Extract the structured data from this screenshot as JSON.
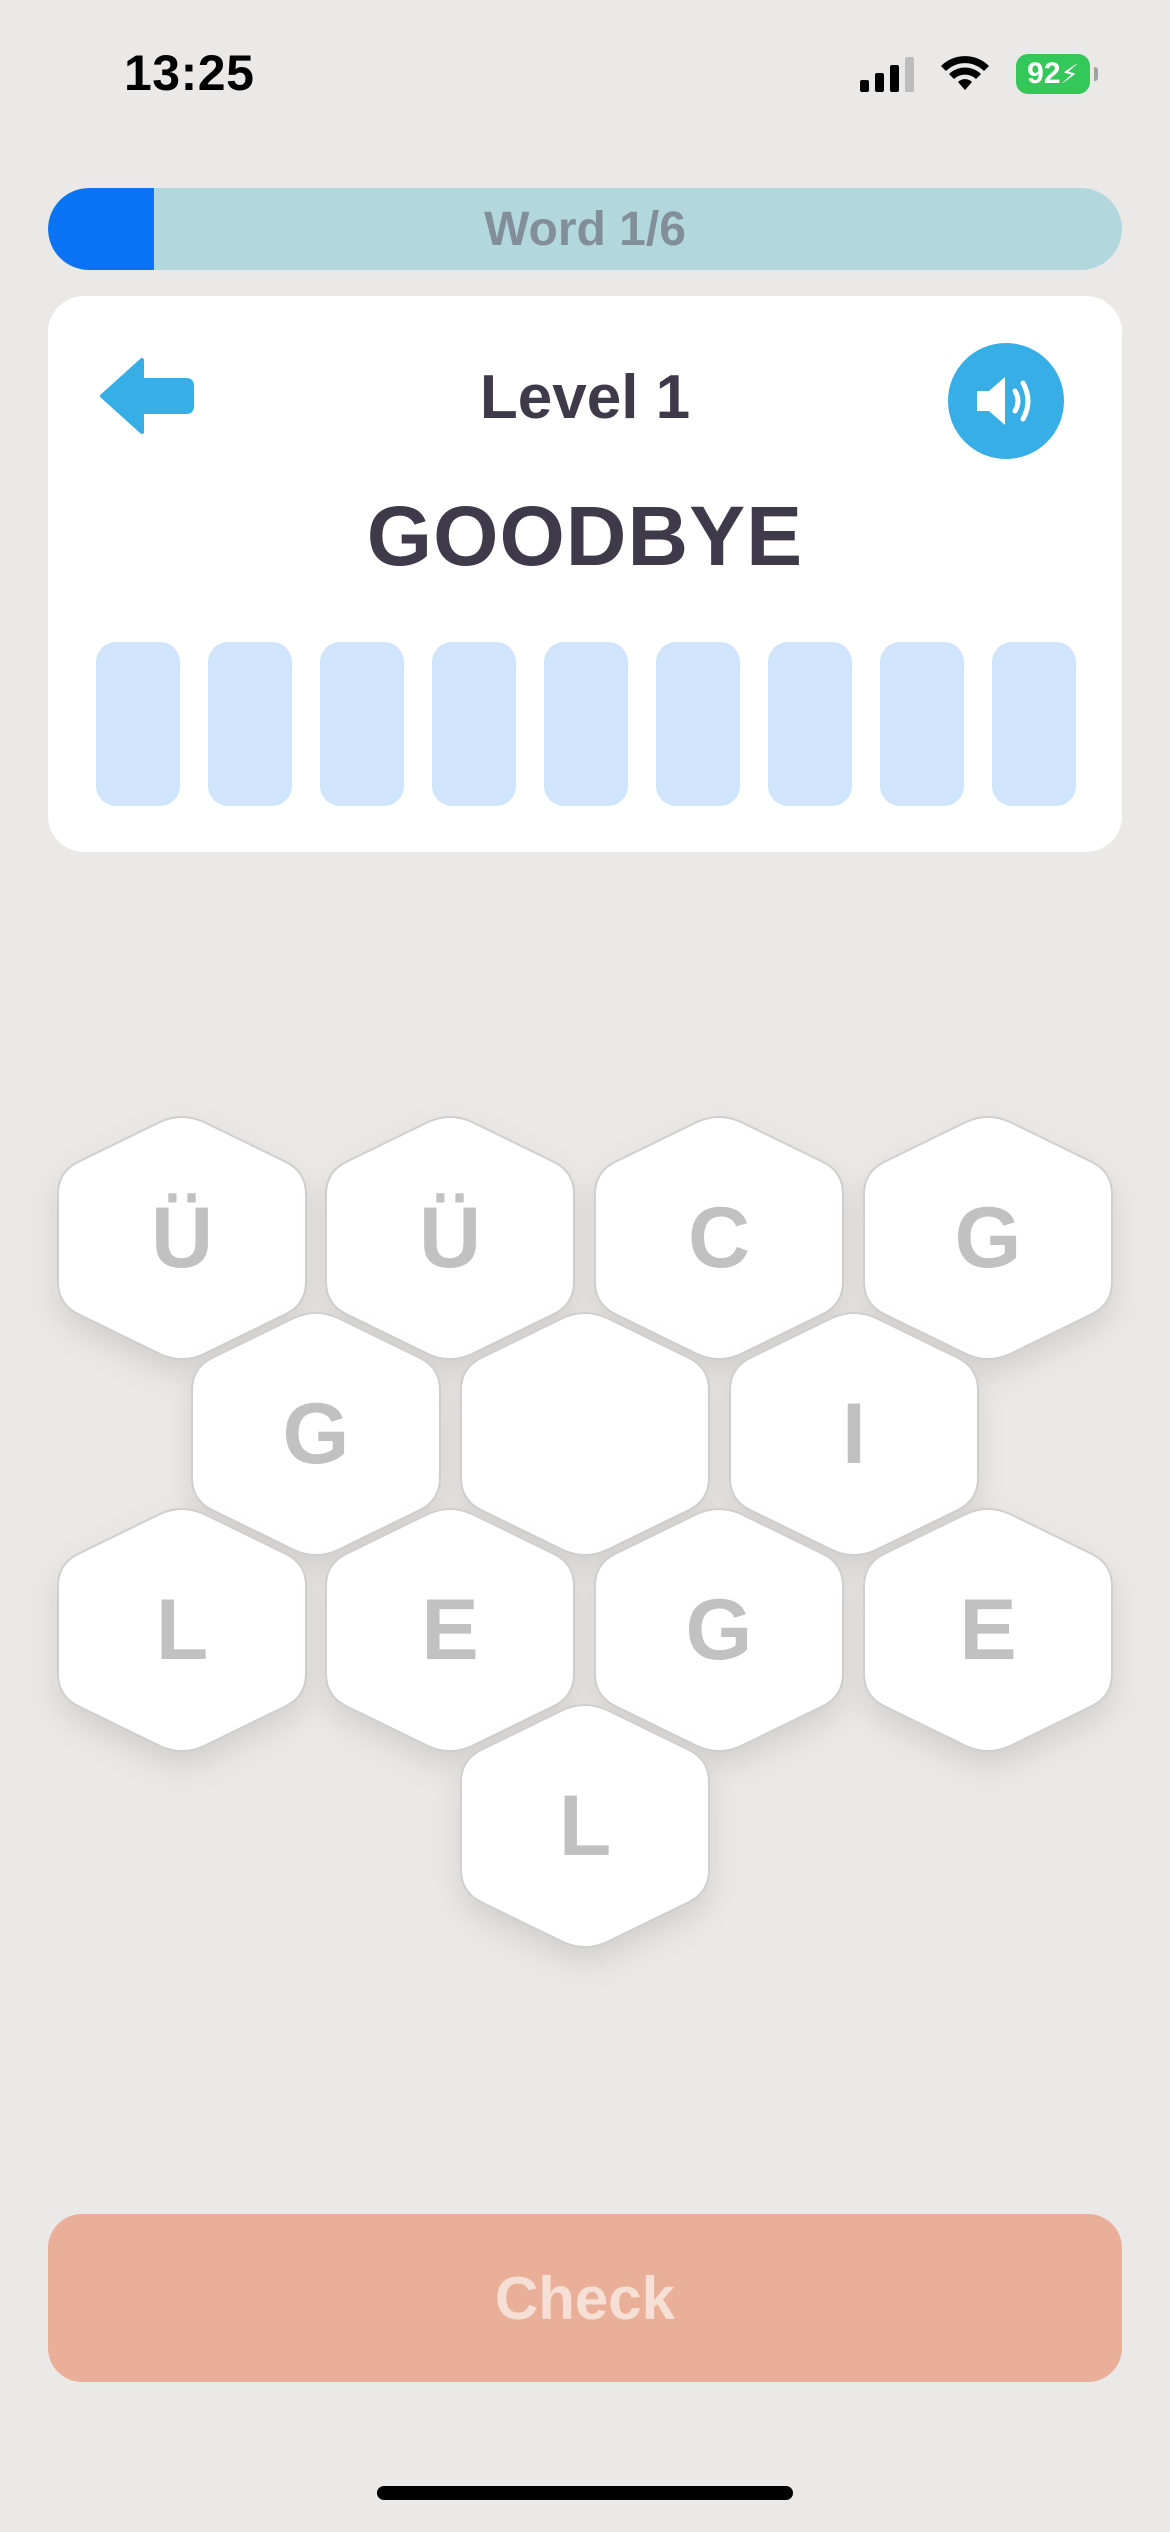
{
  "status_bar": {
    "time": "13:25",
    "battery": "92"
  },
  "progress": {
    "label": "Word 1/6",
    "fraction": 0.0983
  },
  "card": {
    "level_title": "Level 1",
    "word": "GOODBYE",
    "answer_slots": 9,
    "back_icon": "arrow-left-icon",
    "sound_icon": "speaker-icon"
  },
  "hexagons": [
    {
      "letter": "Ü"
    },
    {
      "letter": "Ü"
    },
    {
      "letter": "C"
    },
    {
      "letter": "G"
    },
    {
      "letter": "G"
    },
    {
      "letter": ""
    },
    {
      "letter": "I"
    },
    {
      "letter": "L"
    },
    {
      "letter": "E"
    },
    {
      "letter": "G"
    },
    {
      "letter": "E"
    },
    {
      "letter": "L"
    }
  ],
  "check_button": {
    "label": "Check"
  },
  "colors": {
    "background": "#ebe9e8",
    "progress_fill": "#0a74f4",
    "progress_track": "#b2d8de",
    "accent_blue": "#38aee7",
    "slot": "#d0e4fb",
    "check_button": "#eaaf98"
  }
}
